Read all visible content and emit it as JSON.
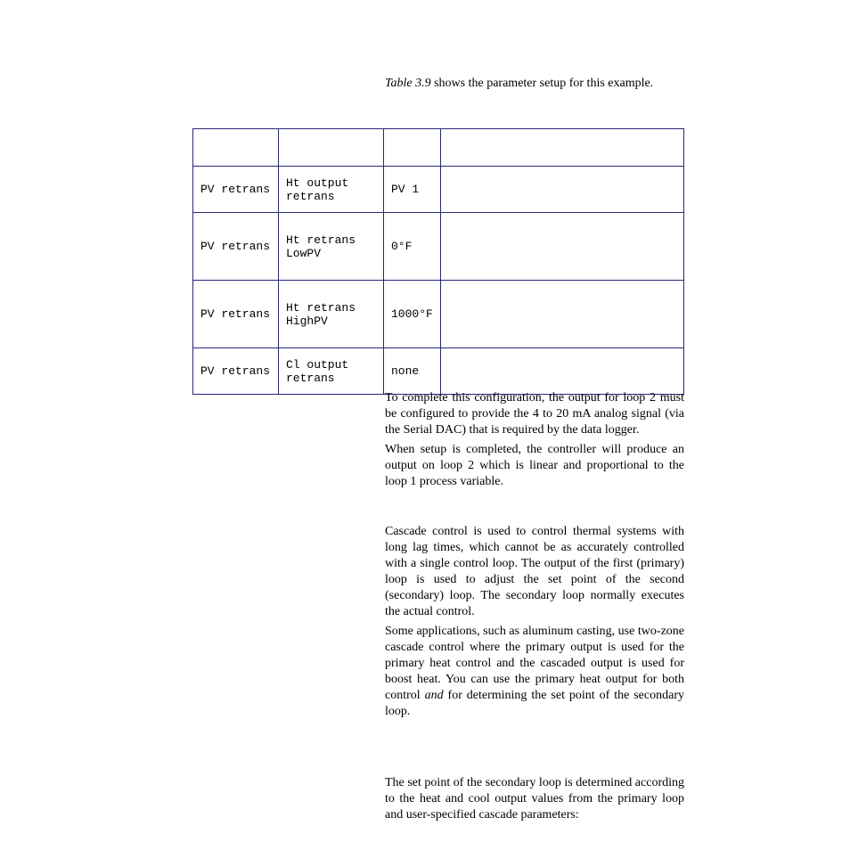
{
  "intro": {
    "italic": "Table 3.9",
    "rest": " shows the parameter setup for this example."
  },
  "table": {
    "headers": [
      "",
      "",
      "",
      ""
    ],
    "rows": [
      {
        "cls": "row-a",
        "cells": [
          "PV retrans",
          "Ht output retrans",
          "PV 1",
          ""
        ]
      },
      {
        "cls": "row-b",
        "cells": [
          "PV retrans",
          "Ht retrans LowPV",
          "0°F",
          ""
        ]
      },
      {
        "cls": "row-c",
        "cells": [
          "PV retrans",
          "Ht retrans HighPV",
          "1000°F",
          ""
        ]
      },
      {
        "cls": "row-d",
        "cells": [
          "PV retrans",
          "Cl output retrans",
          "none",
          ""
        ]
      }
    ]
  },
  "paragraphs": {
    "p1": "To complete this configuration, the output for loop 2 must be configured to provide the 4 to 20 mA analog signal (via the Serial DAC) that is required by the data logger.",
    "p2": "When setup is completed, the controller will produce an output on loop 2 which is linear and proportional to the loop 1 process variable.",
    "p3": "Cascade control is used to control thermal systems with long lag times, which cannot be as accurately controlled with a single control loop. The output of the first (primary) loop is used to adjust the set point of the second (secondary) loop. The secondary loop normally executes the actual control.",
    "p4_pre": "Some applications, such as aluminum casting, use two-zone cascade control where the primary output is used for the primary heat control and the cascaded output is used for boost heat. You can use the primary heat output for both control ",
    "p4_italic": "and",
    "p4_post": " for determining the set point of the secondary loop.",
    "p5": "The set point of the secondary loop is determined according to the heat and cool output values from the primary loop and user-specified cascade parameters:"
  }
}
